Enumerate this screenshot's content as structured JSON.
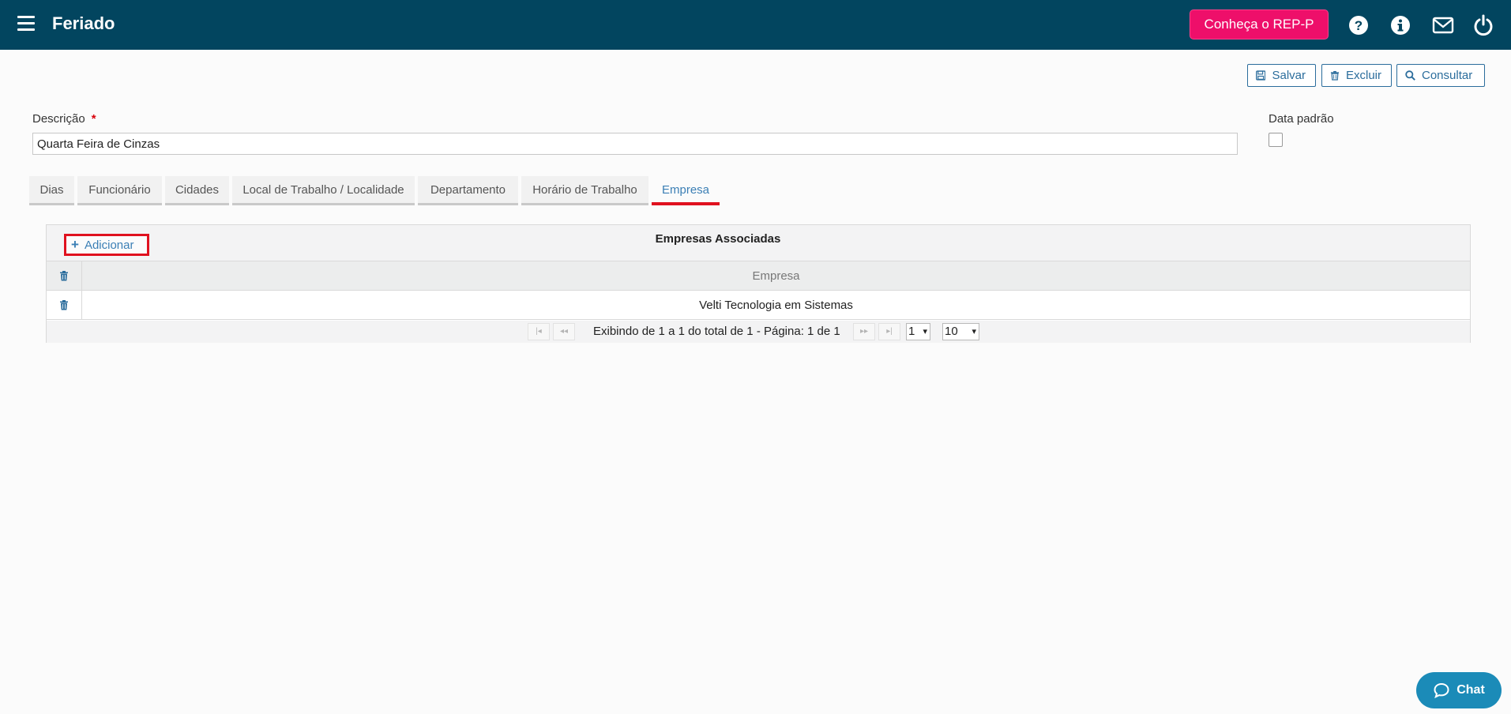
{
  "header": {
    "title": "Feriado",
    "promo_label": "Conheça o REP-P",
    "icons": [
      "menu-icon",
      "help-icon",
      "info-icon",
      "mail-icon",
      "power-icon"
    ],
    "bg_color": "#02455f",
    "promo_color": "#ee0f6a"
  },
  "toolbar": {
    "save_label": "Salvar",
    "delete_label": "Excluir",
    "query_label": "Consultar"
  },
  "form": {
    "description_label": "Descrição",
    "required_mark": "*",
    "description_value": "Quarta Feira de Cinzas",
    "default_date_label": "Data padrão",
    "default_date_checked": false
  },
  "tabs": [
    {
      "label": "Dias",
      "active": false
    },
    {
      "label": "Funcionário",
      "active": false
    },
    {
      "label": "Cidades",
      "active": false
    },
    {
      "label": "Local de Trabalho / Localidade",
      "active": false
    },
    {
      "label": "Departamento",
      "active": false
    },
    {
      "label": "Horário de Trabalho",
      "active": false
    },
    {
      "label": "Empresa",
      "active": true
    }
  ],
  "panel": {
    "add_label": "Adicionar",
    "title": "Empresas Associadas",
    "column_header": "Empresa",
    "rows": [
      {
        "empresa": "Velti Tecnologia em Sistemas"
      }
    ],
    "pager": {
      "first": "|◂",
      "prev": "◂◂",
      "next": "▸▸",
      "last": "▸|",
      "summary": "Exibindo de 1 a 1 do total de 1 - Página: 1 de 1",
      "page_select": "1",
      "rows_per_page": "10"
    }
  },
  "chat": {
    "label": "Chat"
  },
  "accent_color": "#e0111f",
  "link_color": "#3b7fb5"
}
